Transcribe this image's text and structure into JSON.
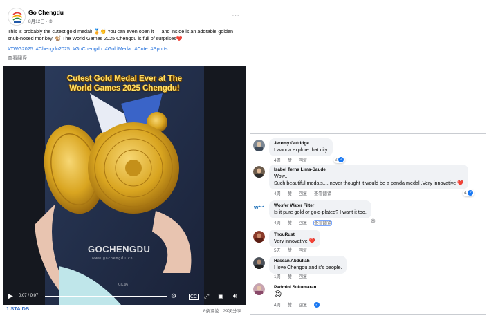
{
  "colors": {
    "link": "#216fdb",
    "like": "#1877f2",
    "heart": "#e0245e",
    "muted": "#65676b",
    "gold": "#d9a520"
  },
  "post": {
    "page_name": "Go Chengdu",
    "date": "8月12日 · ",
    "text": "This is probably the cutest gold medal! 🏅👏 You can even open it — and inside is an adorable golden snub-nosed monkey. 🐒 The World Games 2025 Chengdu is full of surprises❤️",
    "hashtags": [
      "#TWG2025",
      "#Chengdu2025",
      "#GoChengdu",
      "#GoldMedal",
      "#Cute",
      "#Sports"
    ],
    "see_translation": "查看翻译",
    "icons": {
      "avatar": "world-games-logo",
      "audience": "globe-icon",
      "more": "more-dots-icon"
    }
  },
  "video": {
    "overlay_title_line1": "Cutest Gold Medal Ever at The",
    "overlay_title_line2": "World Games 2025 Chengdu!",
    "watermark": "GOCHENGDU",
    "watermark_sub": "www.gochengdu.cn",
    "cc_mark": "CC.96",
    "time": "0:07 / 0:07",
    "progress": 1.0,
    "icons": [
      "play-icon",
      "settings-icon",
      "captions-icon",
      "fullscreen-icon",
      "pip-icon",
      "volume-icon"
    ]
  },
  "footer": {
    "logo_text": "1",
    "source_text": "STA DB",
    "comments_count": "8条评论",
    "views_count": "29次分享"
  },
  "comments": [
    {
      "author": "Jeremy Gutridge",
      "text": "I wanna explore that city",
      "time": "4周",
      "like": "赞",
      "reply": "回复",
      "reaction_count": "2"
    },
    {
      "author": "Isabel Terna Lima-Saude",
      "text": "Wow..",
      "text2": "Such beautiful medals.... never thought it would be a panda medal .Very innovative ❤️",
      "time": "4周",
      "like": "赞",
      "reply": "回复",
      "translate": "查看翻译",
      "reaction_count": "4"
    },
    {
      "author": "Wosfer Water Filter",
      "text": "Is it pure gold or gold-plated? I want it too.",
      "time": "4周",
      "like": "赞",
      "reply": "回复",
      "translate": "查看翻译",
      "reaction_icon": "laughing-emoji"
    },
    {
      "author": "ThouRust",
      "text": "Very innovative ❤️",
      "time": "5天",
      "like": "赞",
      "reply": "回复"
    },
    {
      "author": "Hassan Abdullah",
      "text": "I love Chengdu and it's people.",
      "time": "1周",
      "like": "赞",
      "reply": "回复"
    },
    {
      "author": "Padmini Sukumaran",
      "text": "😍",
      "time": "4周",
      "like": "赞",
      "reply": "回复",
      "reaction_icon": "like-icon"
    }
  ]
}
